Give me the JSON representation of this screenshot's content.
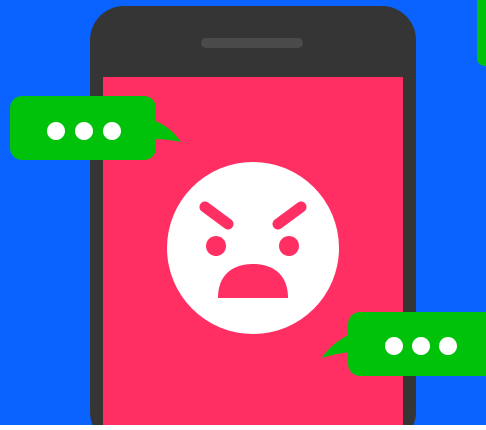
{
  "illustration": {
    "subject": "phone-angry-face-chat",
    "colors": {
      "background": "#0a63ff",
      "phone_body": "#353535",
      "phone_speaker": "#4a4a4a",
      "screen": "#ff2f63",
      "face": "#ffffff",
      "face_features": "#ff2f63",
      "bubble": "#00c20a",
      "dots": "#ffffff"
    },
    "icons": [
      "phone-icon",
      "angry-face-icon",
      "chat-bubble-icon",
      "typing-dots-icon"
    ]
  }
}
